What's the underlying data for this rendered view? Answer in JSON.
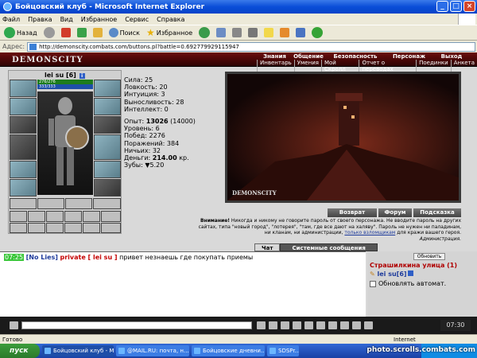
{
  "window": {
    "title": "Бойцовский клуб - Microsoft Internet Explorer"
  },
  "menu": [
    "Файл",
    "Правка",
    "Вид",
    "Избранное",
    "Сервис",
    "Справка"
  ],
  "toolbar": {
    "back": "Назад",
    "search": "Поиск",
    "favorites": "Избранное"
  },
  "address": {
    "label": "Адрес:",
    "url": "http://demonscity.combats.com/buttons.pl?battle=0.692779929115947"
  },
  "game": {
    "logo": "DEMONSCITY",
    "nav_top": [
      "Знания",
      "Общение",
      "Безопасность",
      "Персонаж",
      "Выход"
    ],
    "nav_bottom": [
      "Инвентарь",
      "Умения",
      "Мой Скролл",
      "Отчет о переводах",
      "Поединки",
      "Анкета"
    ],
    "player": {
      "name": "lei su",
      "level": "[6]",
      "info": "i",
      "hp": "276/276",
      "mp": "333/333"
    },
    "stats": {
      "str": "Сила: 25",
      "agi": "Ловкость: 20",
      "int": "Интуиция: 3",
      "end": "Выносливость: 28",
      "intel": "Интеллект: 0",
      "exp_label": "Опыт:",
      "exp_val": "13026",
      "exp_next": "(14000)",
      "level": "Уровень: 6",
      "wins": "Побед: 2276",
      "losses": "Поражений: 384",
      "draws": "Ничьих: 32",
      "money_label": "Деньги:",
      "money_val": "214.00",
      "money_unit": "кр.",
      "teeth_label": "Зубы:",
      "teeth_val": "5.20"
    },
    "scene_tag": "DEMONSCITY",
    "buttons": [
      "Возврат",
      "Форум",
      "Подсказка"
    ],
    "warning": {
      "bold": "Внимание!",
      "text": "Никогда и никому не говорите пароль от своего персонажа. Не вводите пароль на других сайтах, типа \"новый город\", \"лотерея\", \"там, где все дают на халяву\". Пароль не нужен ни паладинам, ни кланам, ни администрации,",
      "link": "только взломщикам",
      "tail": "для кражи вашего героя.",
      "sign": "Администрация."
    },
    "tabs": [
      "Чат",
      "Системные сообщения"
    ],
    "chat": {
      "time": "07:25",
      "from": "[No Lies]",
      "priv": "private [ lei su ]",
      "text": "привет незнаешь где покупать приемы"
    },
    "right": {
      "refresh": "Обновить",
      "street": "Страшилкина улица (1)",
      "user": "lei su",
      "user_lvl": "[6]",
      "auto": "Обновлять автомат."
    },
    "clock": "07:30"
  },
  "status": {
    "left": "Готово",
    "right": "Internet"
  },
  "taskbar": {
    "start": "пуск",
    "tasks": [
      "Бойцовский клуб - M...",
      "@MAIL.RU: почта, н...",
      "Бойцовские дневни...",
      "SDSPr..."
    ]
  },
  "watermark": "photo.scrolls.combats.com"
}
